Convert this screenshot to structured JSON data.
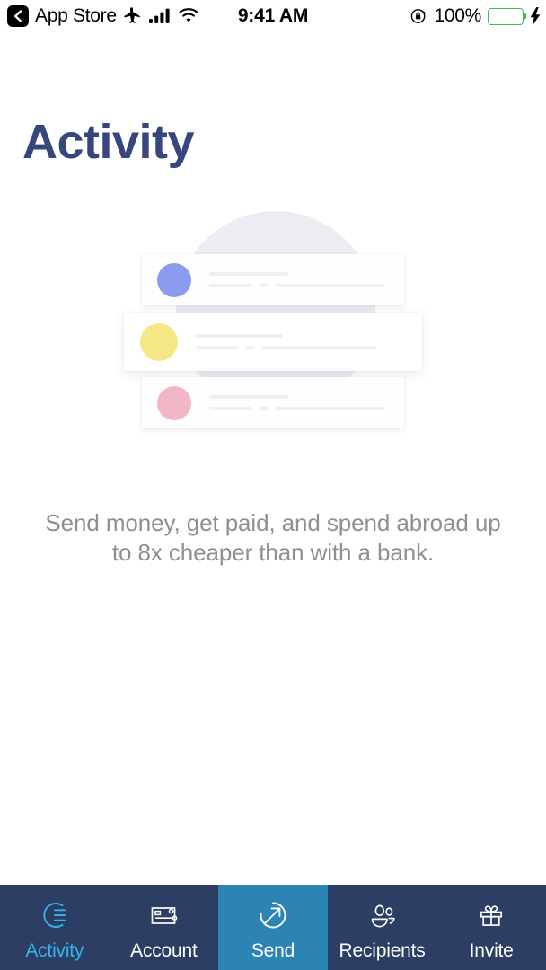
{
  "status_bar": {
    "back_label": "App Store",
    "back_icon": "chevron-left-icon",
    "airplane_icon": "airplane-mode-icon",
    "signal_icon": "cellular-signal-icon",
    "wifi_icon": "wifi-icon",
    "time": "9:41 AM",
    "rotation_lock_icon": "rotation-lock-icon",
    "battery_percent": "100%",
    "battery_icon": "battery-full-icon",
    "charging_icon": "lightning-bolt-icon",
    "battery_color": "#4cd964"
  },
  "header": {
    "title": "Activity",
    "title_color": "#37477d"
  },
  "illustration": {
    "name": "empty-activity-illustration",
    "backdrop_color": "#ebedf2",
    "cards": [
      {
        "avatar_color": "#8b9bf0"
      },
      {
        "avatar_color": "#f5e686"
      },
      {
        "avatar_color": "#f2b7c6"
      }
    ]
  },
  "main": {
    "subtitle": "Send money, get paid, and spend abroad up to 8x cheaper than with a bank."
  },
  "tabbar": {
    "background": "#2c3e64",
    "highlight_color": "#2c84b4",
    "active_color": "#35b3e8",
    "tabs": [
      {
        "label": "Activity",
        "icon": "activity-icon",
        "active": true,
        "highlight": false
      },
      {
        "label": "Account",
        "icon": "card-icon",
        "active": false,
        "highlight": false
      },
      {
        "label": "Send",
        "icon": "send-arrow-icon",
        "active": false,
        "highlight": true
      },
      {
        "label": "Recipients",
        "icon": "people-icon",
        "active": false,
        "highlight": false
      },
      {
        "label": "Invite",
        "icon": "gift-icon",
        "active": false,
        "highlight": false
      }
    ]
  }
}
